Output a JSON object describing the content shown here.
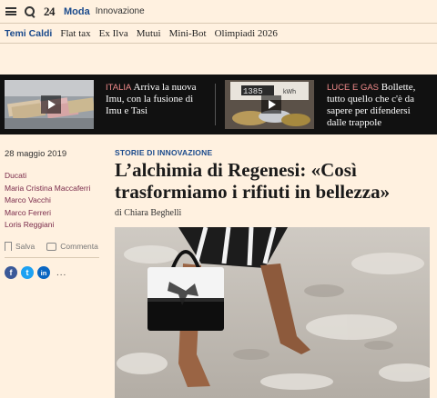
{
  "header": {
    "logo": "24",
    "section": "Moda",
    "subsection": "Innovazione"
  },
  "nav": {
    "hot_label": "Temi Caldi",
    "links": [
      "Flat tax",
      "Ex Ilva",
      "Mutui",
      "Mini-Bot",
      "Olimpiadi 2026"
    ]
  },
  "banner": {
    "items": [
      {
        "tag": "ITALIA",
        "text": "Arriva la nuova Imu, con la fusione di Imu e Tasi"
      },
      {
        "tag": "LUCE E GAS",
        "text": "Bollette, tutto quello che c'è da sapere per difendersi dalle trappole"
      }
    ],
    "meter_digits": "1385",
    "meter_unit": "kWh"
  },
  "article": {
    "date": "28 maggio 2019",
    "authors": [
      "Ducati",
      "Maria Cristina Maccaferri",
      "Marco Vacchi",
      "Marco Ferreri",
      "Loris Reggiani"
    ],
    "save_label": "Salva",
    "comment_label": "Commenta",
    "more": "...",
    "kicker": "STORIE DI INNOVAZIONE",
    "title": "L’alchimia di Regenesi: «Così trasformiamo i rifiuti in bellezza»",
    "byline": "di Chiara Beghelli"
  },
  "social": [
    "f",
    "t",
    "in"
  ],
  "colors": {
    "accent": "#1a4a8c",
    "background": "#fff1e0",
    "banner": "#111111",
    "tag": "#f08a8a",
    "author_link": "#7a2a4a"
  }
}
